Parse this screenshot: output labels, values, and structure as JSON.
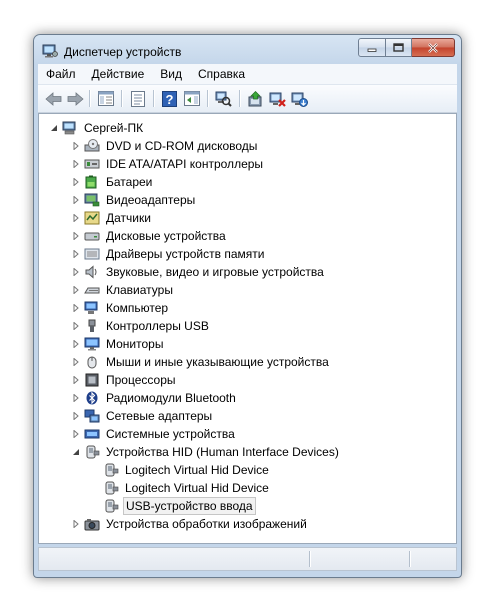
{
  "window": {
    "title": "Диспетчер устройств"
  },
  "menu": [
    "Файл",
    "Действие",
    "Вид",
    "Справка"
  ],
  "toolbar": {
    "back": "back-arrow-icon",
    "forward": "forward-arrow-icon",
    "buttons": [
      "show-hide-console-tree-icon",
      "properties-icon",
      "help-icon",
      "show-action-pane-icon",
      "scan-hardware-icon",
      "update-driver-icon",
      "disable-device-icon",
      "uninstall-device-icon"
    ]
  },
  "tree": {
    "root": "Сергей-ПК",
    "categories": [
      "DVD и CD-ROM дисководы",
      "IDE ATA/ATAPI контроллеры",
      "Батареи",
      "Видеоадаптеры",
      "Датчики",
      "Дисковые устройства",
      "Драйверы устройств памяти",
      "Звуковые, видео и игровые устройства",
      "Клавиатуры",
      "Компьютер",
      "Контроллеры USB",
      "Мониторы",
      "Мыши и иные указывающие устройства",
      "Процессоры",
      "Радиомодули Bluetooth",
      "Сетевые адаптеры",
      "Системные устройства",
      "Устройства HID (Human Interface Devices)"
    ],
    "hid_children": [
      "Logitech Virtual Hid Device",
      "Logitech Virtual Hid Device",
      "USB-устройство ввода"
    ],
    "last_category": "Устройства обработки изображений",
    "selected": "USB-устройство ввода"
  }
}
